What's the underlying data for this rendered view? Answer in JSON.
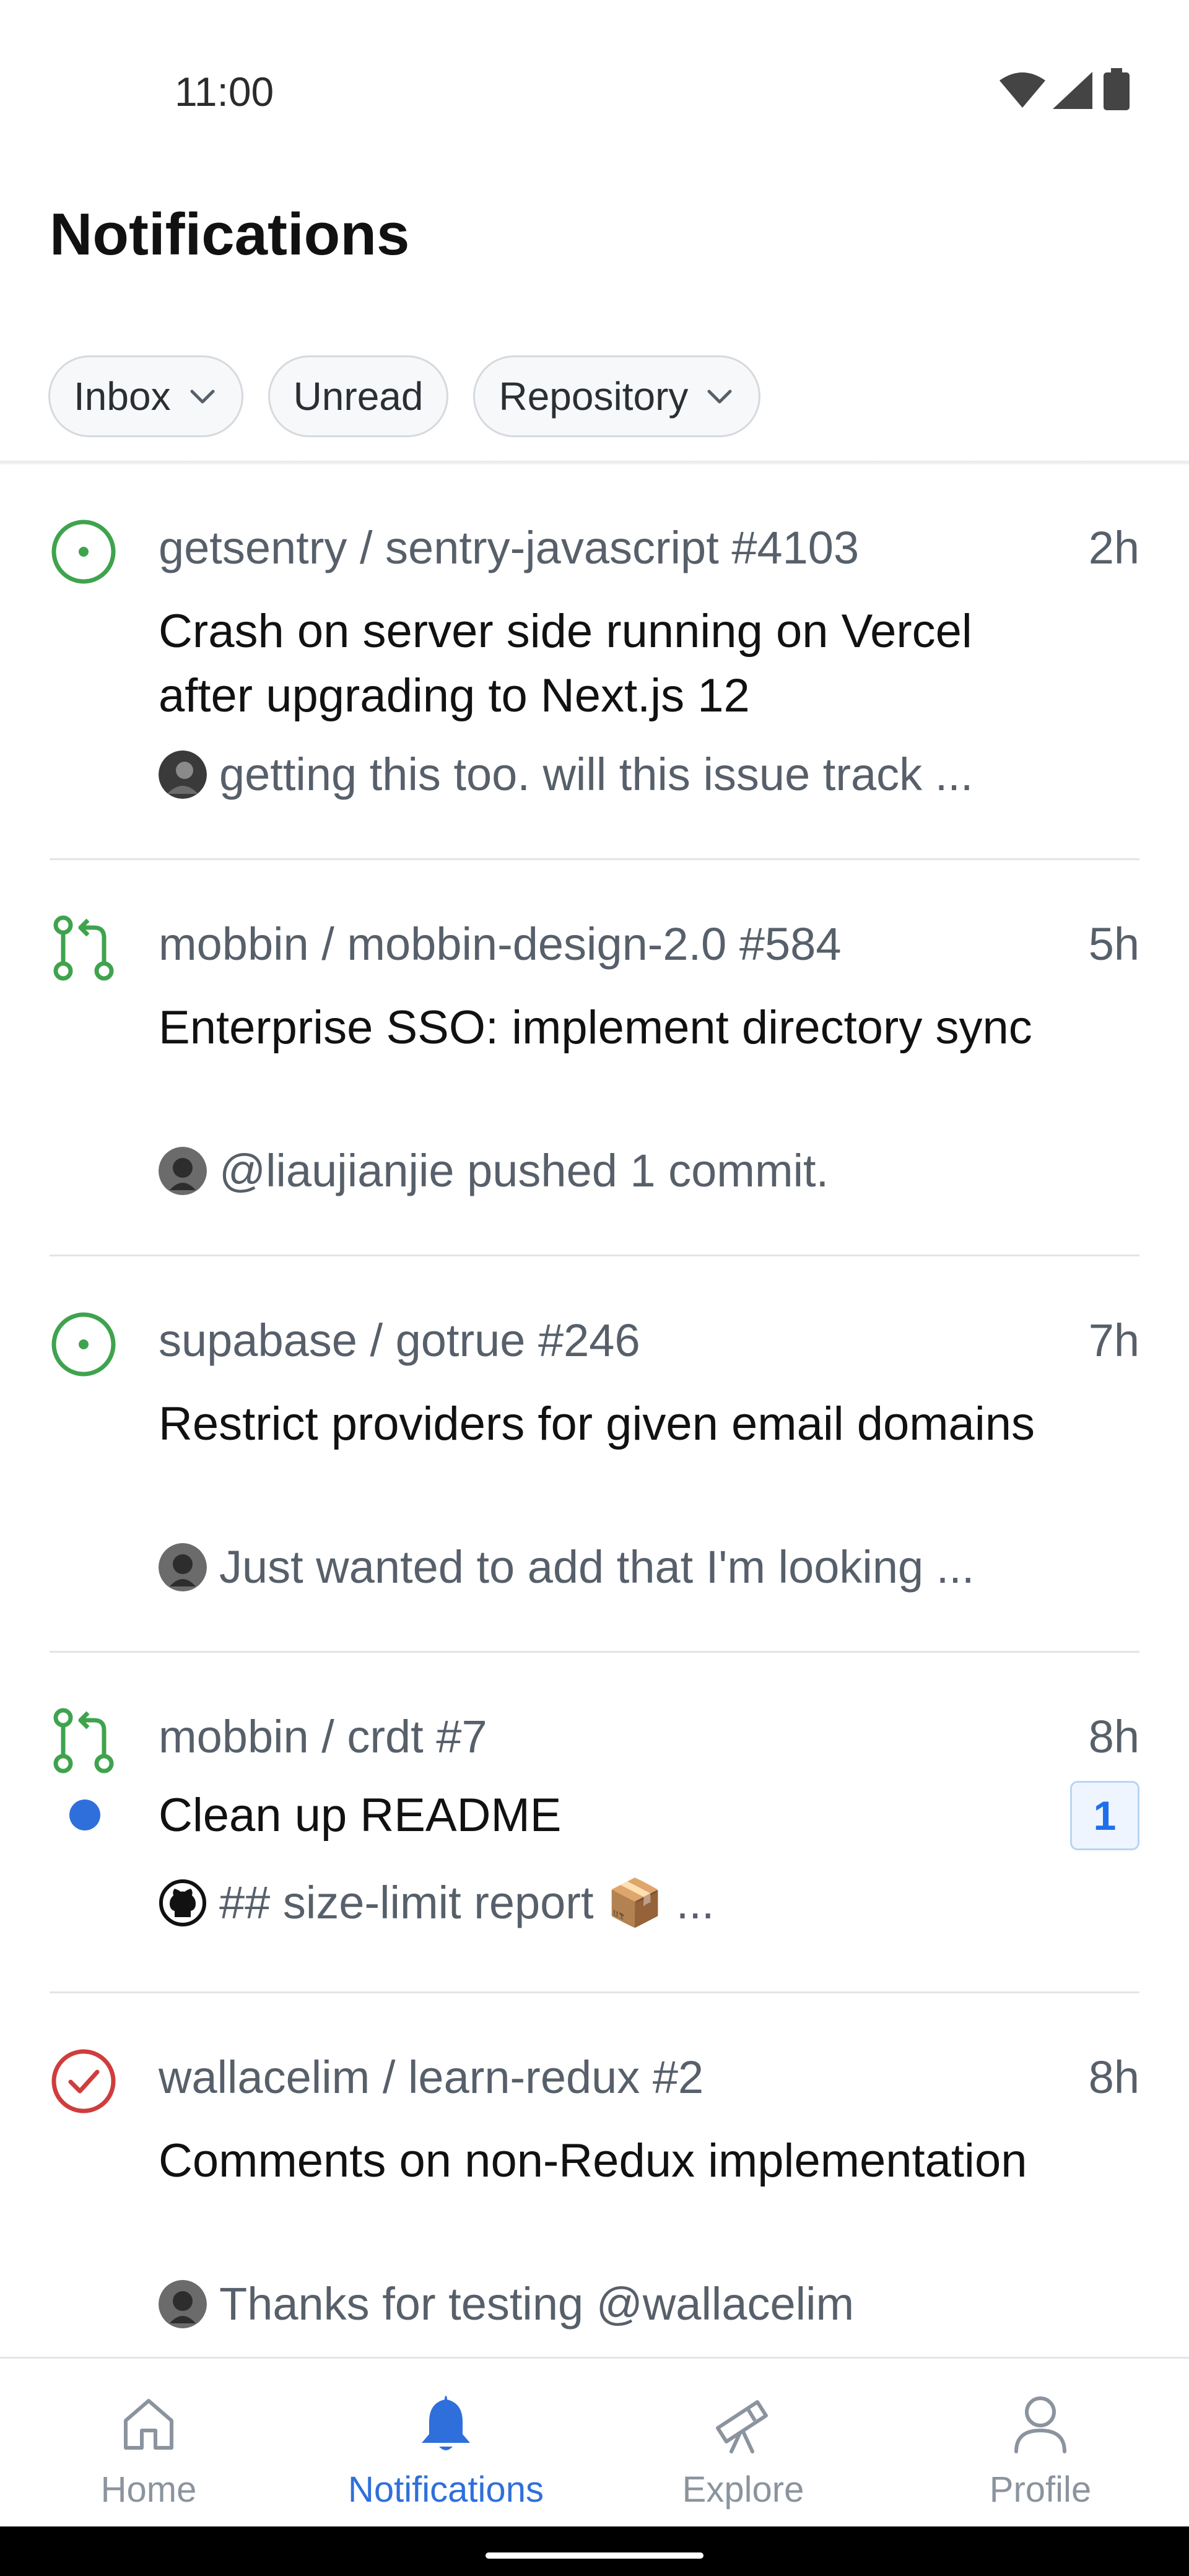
{
  "status_bar": {
    "time": "11:00"
  },
  "header": {
    "title": "Notifications"
  },
  "filters": [
    {
      "label": "Inbox",
      "has_dropdown": true
    },
    {
      "label": "Unread",
      "has_dropdown": false
    },
    {
      "label": "Repository",
      "has_dropdown": true
    }
  ],
  "notifications": [
    {
      "type": "issue-open",
      "repo": "getsentry / sentry-javascript #4103",
      "time": "2h",
      "title": "Crash on server side running on Vercel after upgrading to Next.js 12",
      "preview": "getting this too. will this issue track ...",
      "unread": false
    },
    {
      "type": "pull-request",
      "repo": "mobbin / mobbin-design-2.0 #584",
      "time": "5h",
      "title": "Enterprise SSO: implement directory sync",
      "preview": "@liaujianjie pushed 1 commit.",
      "unread": false
    },
    {
      "type": "issue-open",
      "repo": "supabase / gotrue #246",
      "time": "7h",
      "title": "Restrict providers for given email domains",
      "preview": "Just wanted to add that I'm looking ...",
      "unread": false
    },
    {
      "type": "pull-request",
      "repo": "mobbin / crdt #7",
      "time": "8h",
      "title": "Clean up README",
      "preview": "## size-limit report 📦  ...",
      "unread": true,
      "count": "1"
    },
    {
      "type": "issue-closed",
      "repo": "wallacelim / learn-redux #2",
      "time": "8h",
      "title": "Comments on non-Redux implementation",
      "preview": "Thanks for testing @wallacelim",
      "unread": false
    }
  ],
  "bottom_nav": [
    {
      "label": "Home",
      "icon": "home-icon",
      "active": false
    },
    {
      "label": "Notifications",
      "icon": "bell-icon",
      "active": true
    },
    {
      "label": "Explore",
      "icon": "telescope-icon",
      "active": false
    },
    {
      "label": "Profile",
      "icon": "person-icon",
      "active": false
    }
  ],
  "colors": {
    "accent": "#2f6fdb",
    "open": "#3fa34d",
    "closed": "#cf3d3d",
    "muted": "#57606a"
  }
}
